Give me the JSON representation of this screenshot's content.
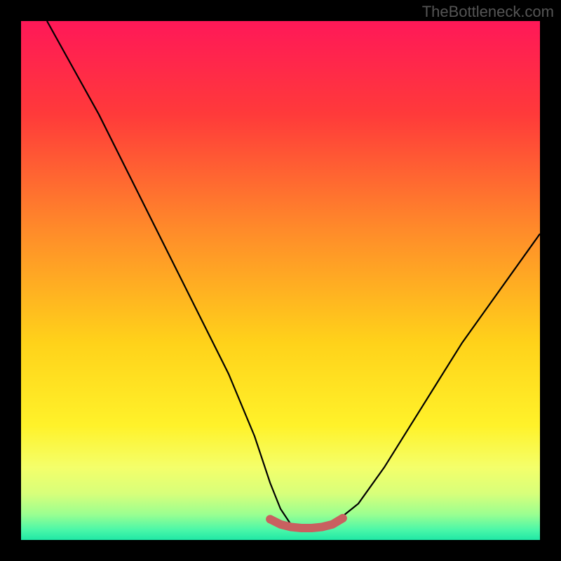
{
  "watermark": "TheBottleneck.com",
  "chart_data": {
    "type": "line",
    "title": "",
    "xlabel": "",
    "ylabel": "",
    "xlim": [
      0,
      100
    ],
    "ylim": [
      0,
      100
    ],
    "series": [
      {
        "name": "bottleneck-curve",
        "x": [
          5,
          10,
          15,
          20,
          25,
          30,
          35,
          40,
          45,
          48,
          50,
          52,
          54,
          56,
          58,
          60,
          65,
          70,
          75,
          80,
          85,
          90,
          95,
          100
        ],
        "values": [
          100,
          91,
          82,
          72,
          62,
          52,
          42,
          32,
          20,
          11,
          6,
          3,
          2,
          2,
          2,
          3,
          7,
          14,
          22,
          30,
          38,
          45,
          52,
          59
        ]
      },
      {
        "name": "bottom-highlight",
        "x": [
          48,
          50,
          52,
          54,
          56,
          58,
          60,
          62
        ],
        "values": [
          4,
          3,
          2.5,
          2.3,
          2.3,
          2.5,
          3,
          4.2
        ]
      }
    ],
    "gradient_stops": [
      {
        "offset": 0,
        "color": "#ff1858"
      },
      {
        "offset": 18,
        "color": "#ff3a3a"
      },
      {
        "offset": 40,
        "color": "#ff8a2a"
      },
      {
        "offset": 62,
        "color": "#ffd21a"
      },
      {
        "offset": 78,
        "color": "#fff22a"
      },
      {
        "offset": 86,
        "color": "#f4ff6a"
      },
      {
        "offset": 91,
        "color": "#d8ff7a"
      },
      {
        "offset": 95,
        "color": "#9cff90"
      },
      {
        "offset": 98,
        "color": "#4cf7a8"
      },
      {
        "offset": 100,
        "color": "#1fe8a6"
      }
    ],
    "bottom_highlight_color": "#c96060"
  }
}
